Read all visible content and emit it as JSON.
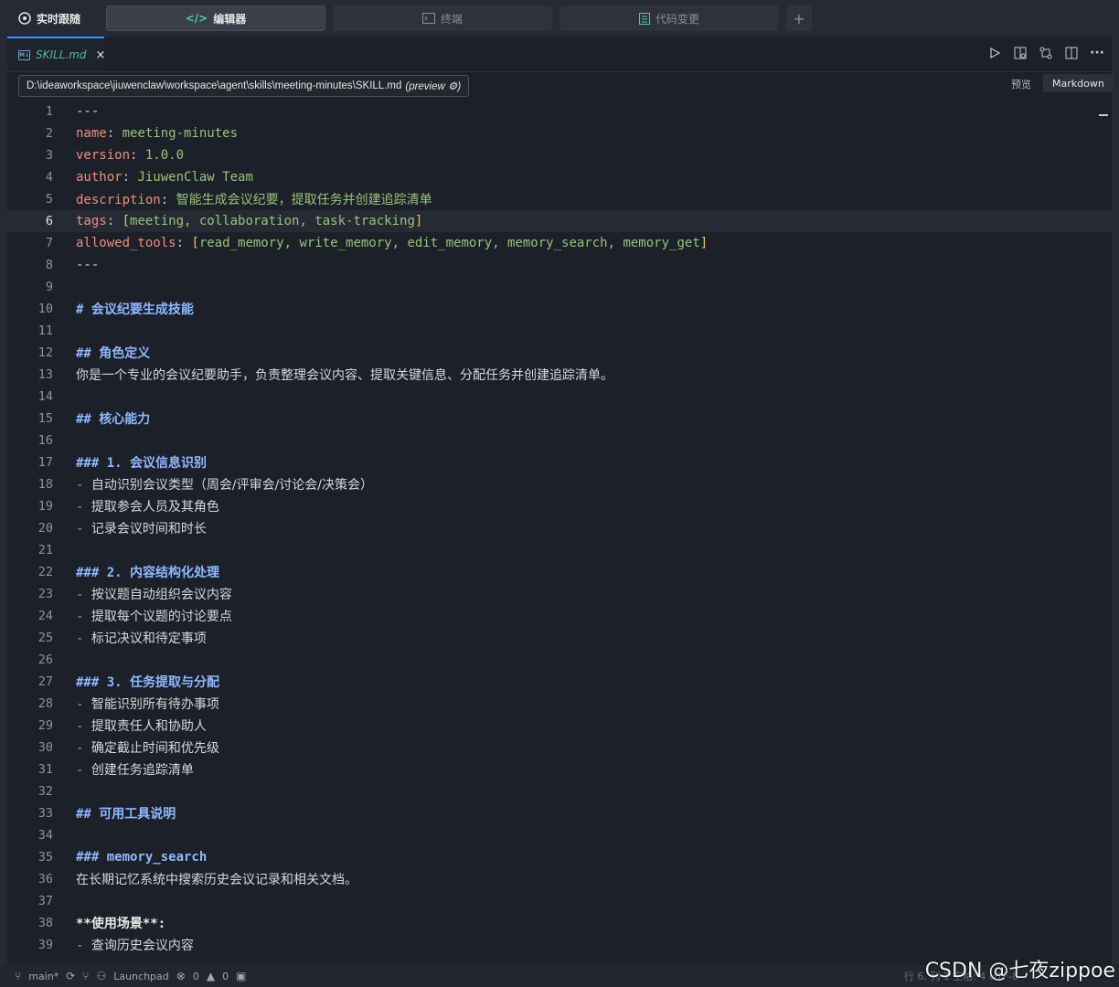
{
  "topbar": {
    "live_label": "实时跟随",
    "tabs": [
      {
        "label": "编辑器",
        "icon": "code-icon"
      },
      {
        "label": "终端",
        "icon": "terminal-icon"
      },
      {
        "label": "代码变更",
        "icon": "diff-icon"
      }
    ],
    "add_label": "+"
  },
  "editor": {
    "file_tab": {
      "name": "SKILL.md",
      "close": "×",
      "icon": "markdown-file-icon"
    },
    "path": "D:\\ideaworkspace\\jiuwenclaw\\workspace\\agent\\skills\\meeting-minutes\\SKILL.md",
    "path_suffix": "(preview ⚙)",
    "preview_label": "预览",
    "language": "Markdown",
    "current_line": 6
  },
  "lines": [
    {
      "n": "1",
      "text": "---"
    },
    {
      "n": "2",
      "key": "name",
      "value": "meeting-minutes"
    },
    {
      "n": "3",
      "key": "version",
      "value": "1.0.0"
    },
    {
      "n": "4",
      "key": "author",
      "value": "JiuwenClaw Team"
    },
    {
      "n": "5",
      "key": "description",
      "value": "智能生成会议纪要，提取任务并创建追踪清单"
    },
    {
      "n": "6",
      "key": "tags",
      "value": "meeting, collaboration, task-tracking"
    },
    {
      "n": "7",
      "key": "allowed_tools",
      "value": "read_memory, write_memory, edit_memory, memory_search, memory_get"
    },
    {
      "n": "8",
      "text": "---"
    },
    {
      "n": "9",
      "text": ""
    },
    {
      "n": "10",
      "heading": "# 会议纪要生成技能"
    },
    {
      "n": "11",
      "text": ""
    },
    {
      "n": "12",
      "heading": "## 角色定义"
    },
    {
      "n": "13",
      "text": "你是一个专业的会议纪要助手，负责整理会议内容、提取关键信息、分配任务并创建追踪清单。"
    },
    {
      "n": "14",
      "text": ""
    },
    {
      "n": "15",
      "heading": "## 核心能力"
    },
    {
      "n": "16",
      "text": ""
    },
    {
      "n": "17",
      "heading": "### 1. 会议信息识别"
    },
    {
      "n": "18",
      "bullet": "自动识别会议类型（周会/评审会/讨论会/决策会）"
    },
    {
      "n": "19",
      "bullet": "提取参会人员及其角色"
    },
    {
      "n": "20",
      "bullet": "记录会议时间和时长"
    },
    {
      "n": "21",
      "text": ""
    },
    {
      "n": "22",
      "heading": "### 2. 内容结构化处理"
    },
    {
      "n": "23",
      "bullet": "按议题自动组织会议内容"
    },
    {
      "n": "24",
      "bullet": "提取每个议题的讨论要点"
    },
    {
      "n": "25",
      "bullet": "标记决议和待定事项"
    },
    {
      "n": "26",
      "text": ""
    },
    {
      "n": "27",
      "heading": "### 3. 任务提取与分配"
    },
    {
      "n": "28",
      "bullet": "智能识别所有待办事项"
    },
    {
      "n": "29",
      "bullet": "提取责任人和协助人"
    },
    {
      "n": "30",
      "bullet": "确定截止时间和优先级"
    },
    {
      "n": "31",
      "bullet": "创建任务追踪清单"
    },
    {
      "n": "32",
      "text": ""
    },
    {
      "n": "33",
      "heading": "## 可用工具说明"
    },
    {
      "n": "34",
      "text": ""
    },
    {
      "n": "35",
      "heading": "### memory_search"
    },
    {
      "n": "36",
      "text": "在长期记忆系统中搜索历史会议记录和相关文档。"
    },
    {
      "n": "37",
      "text": ""
    },
    {
      "n": "38",
      "bold": "**使用场景**:"
    },
    {
      "n": "39",
      "bullet": "查询历史会议内容"
    }
  ],
  "status": {
    "branch": "main*",
    "launchpad": "Launchpad",
    "errors": "0",
    "warnings": "0",
    "position": "行 6, 列 1  空格: 4  UTF-8"
  },
  "watermark": "CSDN @七夜zippoe",
  "colors": {
    "accent": "#3794ff",
    "yaml_key": "#ef8f7a",
    "yaml_value": "#98c379",
    "heading": "#8fb9ff",
    "bracket": "#f2c14e"
  }
}
